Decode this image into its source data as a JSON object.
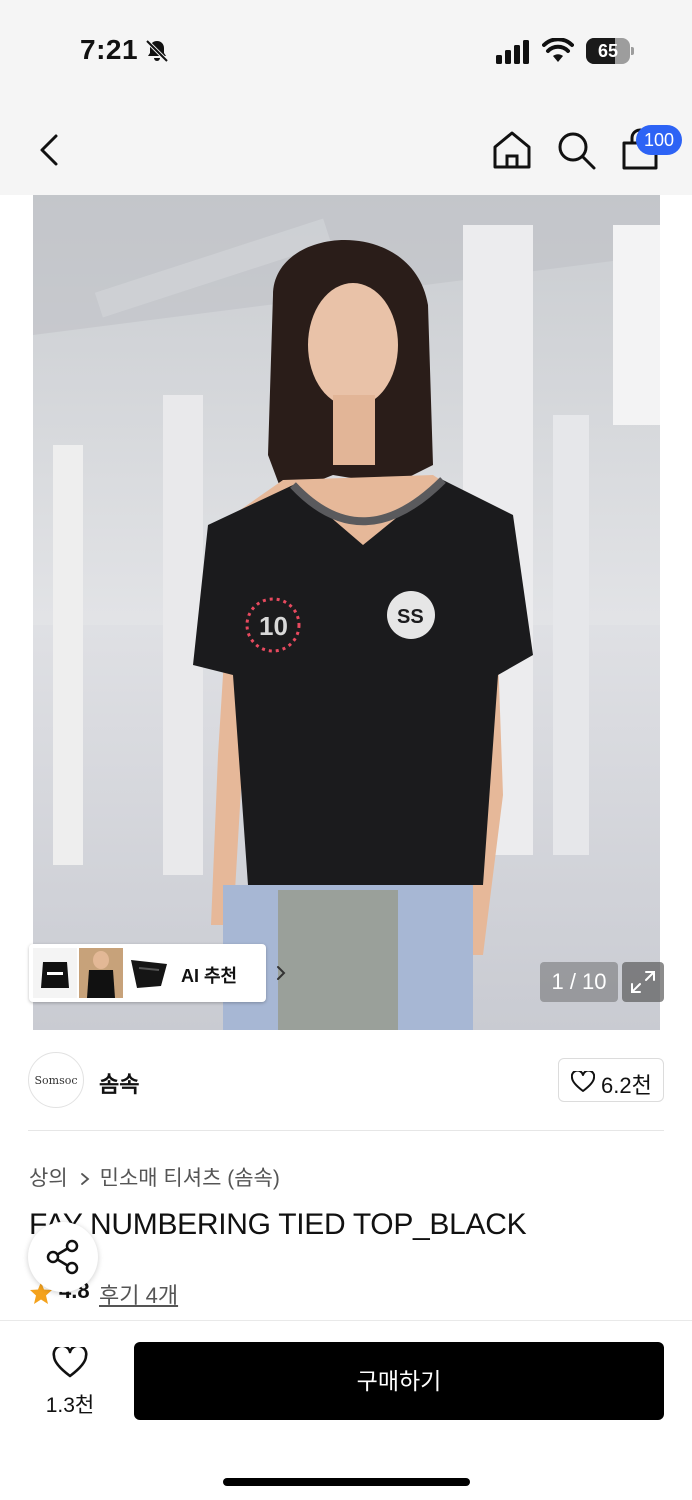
{
  "status_bar": {
    "time": "7:21",
    "battery": "65",
    "battery_level": 0.65
  },
  "nav": {
    "cart_badge": "100",
    "icons": [
      "back-icon",
      "home-icon",
      "search-icon",
      "cart-icon"
    ]
  },
  "gallery": {
    "counter": "1 / 10",
    "ai_recommend_label": "AI 추천",
    "background_color": "#d9dade"
  },
  "brand": {
    "logo_text": "Somsoc",
    "name": "솜속",
    "likes": "6.2천"
  },
  "product": {
    "breadcrumb": [
      "상의",
      "민소매 티셔츠 (솜속)"
    ],
    "title": "FAY NUMBERING TIED TOP_BLACK",
    "rating": "4.8",
    "reviews": "후기 4개"
  },
  "purchase_bar": {
    "wish_count": "1.3천",
    "buy_label": "구매하기",
    "buy_color": "#000000"
  },
  "colors": {
    "accent_badge": "#2d63f5",
    "star": "#f4a21c"
  }
}
